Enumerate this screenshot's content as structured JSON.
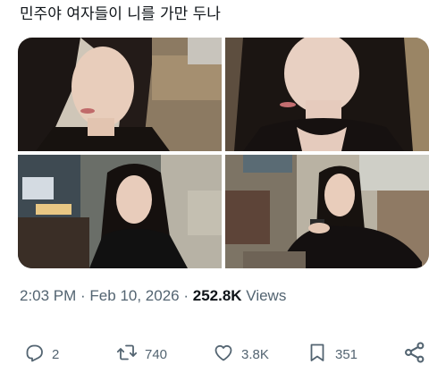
{
  "tweet": {
    "text": "민주야 여자들이 니를 가만 두나"
  },
  "meta": {
    "time": "2:03 PM",
    "separator": " · ",
    "date": "Feb 10, 2026",
    "views_count": "252.8K",
    "views_label": "Views"
  },
  "actions": {
    "reply_count": "2",
    "repost_count": "740",
    "like_count": "3.8K",
    "bookmark_count": "351"
  },
  "media": {
    "photo_count": 4
  },
  "colors": {
    "text": "#0f1419",
    "secondary": "#536471",
    "background": "#ffffff"
  }
}
